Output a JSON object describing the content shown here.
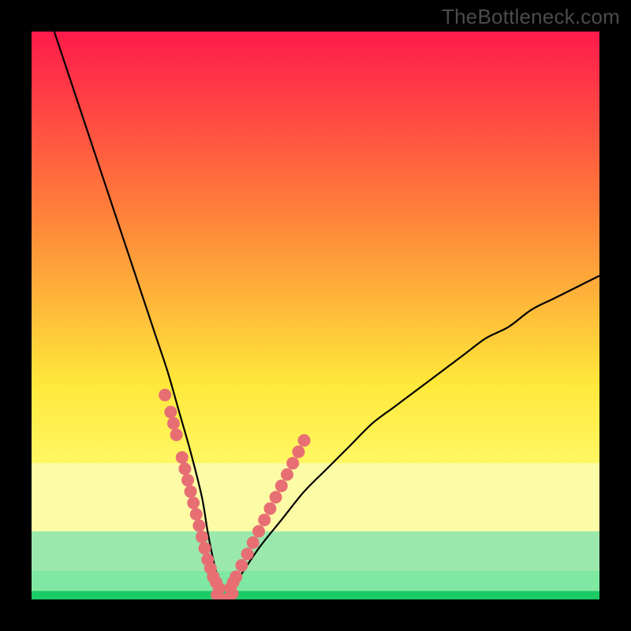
{
  "watermark": "TheBottleneck.com",
  "colors": {
    "frame": "#000000",
    "gradient_top": "#ff1a4b",
    "gradient_mid_orange": "#ff7a3a",
    "gradient_yellow": "#ffe83a",
    "gradient_pale_yellow": "#fdfca6",
    "green_dark": "#1bca66",
    "green_light": "#7fe8a3",
    "curve": "#000000",
    "dots": "#e76f74"
  },
  "chart_data": {
    "type": "line",
    "title": "",
    "xlabel": "",
    "ylabel": "",
    "xlim": [
      0,
      100
    ],
    "ylim": [
      0,
      100
    ],
    "series": [
      {
        "name": "bottleneck-curve",
        "x": [
          4,
          6,
          8,
          10,
          12,
          14,
          16,
          18,
          20,
          22,
          24,
          26,
          28,
          30,
          31,
          32,
          33,
          34,
          36,
          40,
          44,
          48,
          52,
          56,
          60,
          64,
          68,
          72,
          76,
          80,
          84,
          88,
          92,
          96,
          100
        ],
        "values": [
          100,
          94,
          88,
          82,
          76,
          70,
          64,
          58,
          52,
          46,
          40,
          33,
          26,
          18,
          12,
          7,
          3,
          0,
          3,
          9,
          14,
          19,
          23,
          27,
          31,
          34,
          37,
          40,
          43,
          46,
          48,
          51,
          53,
          55,
          57
        ]
      }
    ],
    "dots_left": {
      "name": "left-arm-dots",
      "x": [
        23.5,
        24.5,
        25.0,
        25.5,
        26.5,
        27.0,
        27.5,
        28.0,
        28.5,
        29.0,
        29.5,
        30.0,
        30.5,
        31.0,
        31.5,
        32.0,
        32.5,
        33.0
      ],
      "values": [
        36,
        33,
        31,
        29,
        25,
        23,
        21,
        19,
        17,
        15,
        13,
        11,
        9,
        7,
        5.5,
        4,
        3,
        2
      ]
    },
    "dots_right": {
      "name": "right-arm-dots",
      "x": [
        35.0,
        35.5,
        36.0,
        37.0,
        38.0,
        39.0,
        40.0,
        41.0,
        42.0,
        43.0,
        44.0,
        45.0,
        46.0,
        47.0,
        48.0
      ],
      "values": [
        2,
        3,
        4,
        6,
        8,
        10,
        12,
        14,
        16,
        18,
        20,
        22,
        24,
        26,
        28
      ]
    },
    "dots_bottom": {
      "name": "valley-dots",
      "x": [
        32.5,
        33.0,
        33.5,
        34.0,
        34.5,
        35.0,
        35.5
      ],
      "values": [
        0.8,
        0.4,
        0.2,
        0.1,
        0.2,
        0.5,
        1.0
      ]
    },
    "bands": {
      "pale_yellow": {
        "from_y": 24,
        "to_y": 12
      },
      "green_top": {
        "from_y": 12,
        "to_y": 5
      },
      "green_mid": {
        "from_y": 5,
        "to_y": 1.5
      },
      "green_bot": {
        "from_y": 1.5,
        "to_y": 0
      }
    }
  }
}
